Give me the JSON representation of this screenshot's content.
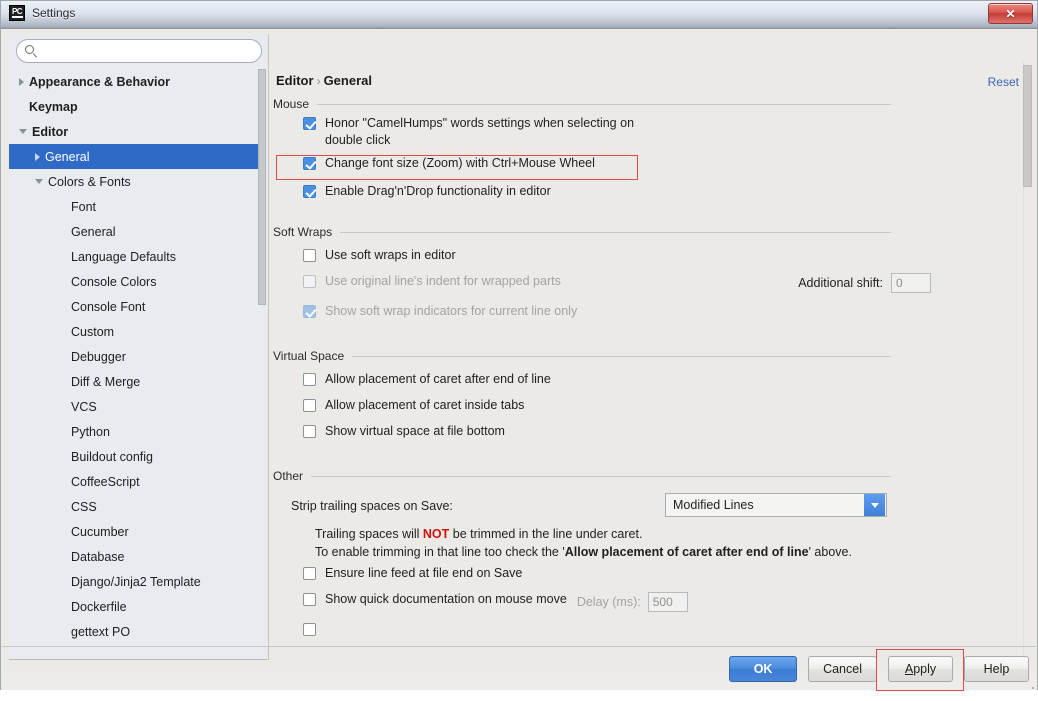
{
  "window": {
    "title": "Settings",
    "app_icon": "pycharm-icon",
    "close_label": "✕"
  },
  "sidebar": {
    "search": {
      "value": "",
      "placeholder": ""
    },
    "items": [
      {
        "label": "Appearance & Behavior",
        "indent": 0,
        "arrow": "right",
        "bold": true,
        "selected": false
      },
      {
        "label": "Keymap",
        "indent": 0,
        "arrow": "none",
        "bold": true,
        "selected": false
      },
      {
        "label": "Editor",
        "indent": 0,
        "arrow": "down",
        "bold": true,
        "selected": false
      },
      {
        "label": "General",
        "indent": 1,
        "arrow": "right",
        "bold": false,
        "selected": true
      },
      {
        "label": "Colors & Fonts",
        "indent": 1,
        "arrow": "down",
        "bold": false,
        "selected": false
      },
      {
        "label": "Font",
        "indent": 2,
        "arrow": "none",
        "bold": false,
        "selected": false
      },
      {
        "label": "General",
        "indent": 2,
        "arrow": "none",
        "bold": false,
        "selected": false
      },
      {
        "label": "Language Defaults",
        "indent": 2,
        "arrow": "none",
        "bold": false,
        "selected": false
      },
      {
        "label": "Console Colors",
        "indent": 2,
        "arrow": "none",
        "bold": false,
        "selected": false
      },
      {
        "label": "Console Font",
        "indent": 2,
        "arrow": "none",
        "bold": false,
        "selected": false
      },
      {
        "label": "Custom",
        "indent": 2,
        "arrow": "none",
        "bold": false,
        "selected": false
      },
      {
        "label": "Debugger",
        "indent": 2,
        "arrow": "none",
        "bold": false,
        "selected": false
      },
      {
        "label": "Diff & Merge",
        "indent": 2,
        "arrow": "none",
        "bold": false,
        "selected": false
      },
      {
        "label": "VCS",
        "indent": 2,
        "arrow": "none",
        "bold": false,
        "selected": false
      },
      {
        "label": "Python",
        "indent": 2,
        "arrow": "none",
        "bold": false,
        "selected": false
      },
      {
        "label": "Buildout config",
        "indent": 2,
        "arrow": "none",
        "bold": false,
        "selected": false
      },
      {
        "label": "CoffeeScript",
        "indent": 2,
        "arrow": "none",
        "bold": false,
        "selected": false
      },
      {
        "label": "CSS",
        "indent": 2,
        "arrow": "none",
        "bold": false,
        "selected": false
      },
      {
        "label": "Cucumber",
        "indent": 2,
        "arrow": "none",
        "bold": false,
        "selected": false
      },
      {
        "label": "Database",
        "indent": 2,
        "arrow": "none",
        "bold": false,
        "selected": false
      },
      {
        "label": "Django/Jinja2 Template",
        "indent": 2,
        "arrow": "none",
        "bold": false,
        "selected": false
      },
      {
        "label": "Dockerfile",
        "indent": 2,
        "arrow": "none",
        "bold": false,
        "selected": false
      },
      {
        "label": "gettext PO",
        "indent": 2,
        "arrow": "none",
        "bold": false,
        "selected": false
      }
    ]
  },
  "main": {
    "breadcrumb": {
      "root": "Editor",
      "separator": "›",
      "leaf": "General"
    },
    "reset_label": "Reset",
    "groups": {
      "mouse": {
        "title": "Mouse",
        "options": [
          {
            "label": "Honor \"CamelHumps\" words settings when selecting on double click",
            "checked": true,
            "disabled": false,
            "highlighted": false
          },
          {
            "label": "Change font size (Zoom) with Ctrl+Mouse Wheel",
            "checked": true,
            "disabled": false,
            "highlighted": true
          },
          {
            "label": "Enable Drag'n'Drop functionality in editor",
            "checked": true,
            "disabled": false,
            "highlighted": false
          }
        ]
      },
      "soft_wraps": {
        "title": "Soft Wraps",
        "options": [
          {
            "label": "Use soft wraps in editor",
            "checked": false,
            "disabled": false
          },
          {
            "label": "Use original line's indent for wrapped parts",
            "checked": false,
            "disabled": true
          },
          {
            "label": "Show soft wrap indicators for current line only",
            "checked": true,
            "disabled": true
          }
        ],
        "additional_shift_label": "Additional shift:",
        "additional_shift_value": "0"
      },
      "virtual_space": {
        "title": "Virtual Space",
        "options": [
          {
            "label": "Allow placement of caret after end of line",
            "checked": false,
            "disabled": false
          },
          {
            "label": "Allow placement of caret inside tabs",
            "checked": false,
            "disabled": false
          },
          {
            "label": "Show virtual space at file bottom",
            "checked": false,
            "disabled": false
          }
        ]
      },
      "other": {
        "title": "Other",
        "strip_label": "Strip trailing spaces on Save:",
        "strip_value": "Modified Lines",
        "note_line1_pre": "Trailing spaces will ",
        "note_line1_red": "NOT",
        "note_line1_post": " be trimmed in the line under caret.",
        "note_line2_pre": "To enable trimming in that line too check the '",
        "note_line2_bold": "Allow placement of caret after end of line",
        "note_line2_post": "' above.",
        "options": [
          {
            "label": "Ensure line feed at file end on Save",
            "checked": false,
            "disabled": false
          },
          {
            "label": "Show quick documentation on mouse move",
            "checked": false,
            "disabled": false
          }
        ],
        "delay_label": "Delay (ms):",
        "delay_value": "500"
      }
    }
  },
  "footer": {
    "buttons": [
      {
        "name": "ok",
        "label": "OK",
        "primary": true,
        "mnemonic": null,
        "highlighted": false
      },
      {
        "name": "cancel",
        "label": "Cancel",
        "primary": false,
        "mnemonic": null,
        "highlighted": false
      },
      {
        "name": "apply",
        "label": "Apply",
        "primary": false,
        "mnemonic": "A",
        "highlighted": true
      },
      {
        "name": "help",
        "label": "Help",
        "primary": false,
        "mnemonic": null,
        "highlighted": false
      }
    ]
  },
  "colors": {
    "selection_blue": "#2f6ac7",
    "accent_blue": "#4a90e2",
    "highlight_red": "#e04a4a",
    "link_blue": "#3a63b8",
    "warning_red": "#d01010"
  }
}
